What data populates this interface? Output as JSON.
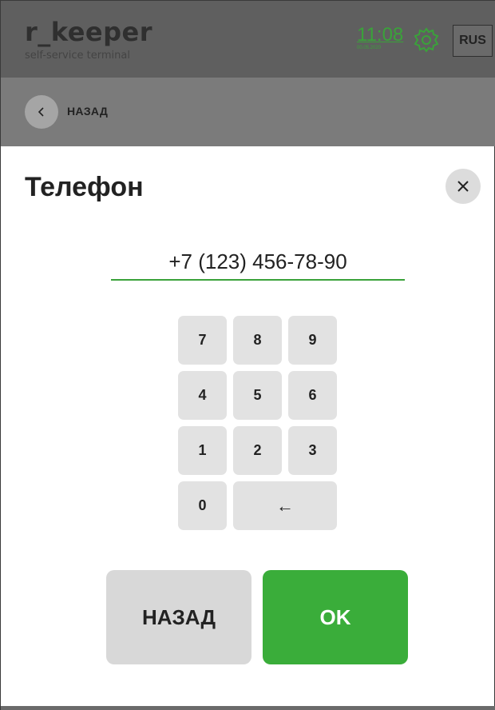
{
  "header": {
    "brand": "r_keeper",
    "subtitle": "self-service terminal",
    "time": "11:08",
    "date": "00.05.2020",
    "settings_icon": "gear-icon",
    "language": "RUS"
  },
  "nav": {
    "back_label": "НАЗАД",
    "back_icon": "chevron-left-icon"
  },
  "dialog": {
    "title": "Телефон",
    "close_icon": "close-icon",
    "phone_value": "+7 (123) 456-78-90"
  },
  "keypad": {
    "keys": [
      {
        "label": "7"
      },
      {
        "label": "8"
      },
      {
        "label": "9"
      },
      {
        "label": "4"
      },
      {
        "label": "5"
      },
      {
        "label": "6"
      },
      {
        "label": "1"
      },
      {
        "label": "2"
      },
      {
        "label": "3"
      },
      {
        "label": "0"
      },
      {
        "label": "←"
      }
    ]
  },
  "actions": {
    "back_button": "НАЗАД",
    "ok_button": "OK"
  },
  "colors": {
    "accent": "#3aad3a",
    "header_bg": "#5f5f5f",
    "backbar_bg": "#7b7b7b",
    "key_bg": "#e2e2e2"
  }
}
